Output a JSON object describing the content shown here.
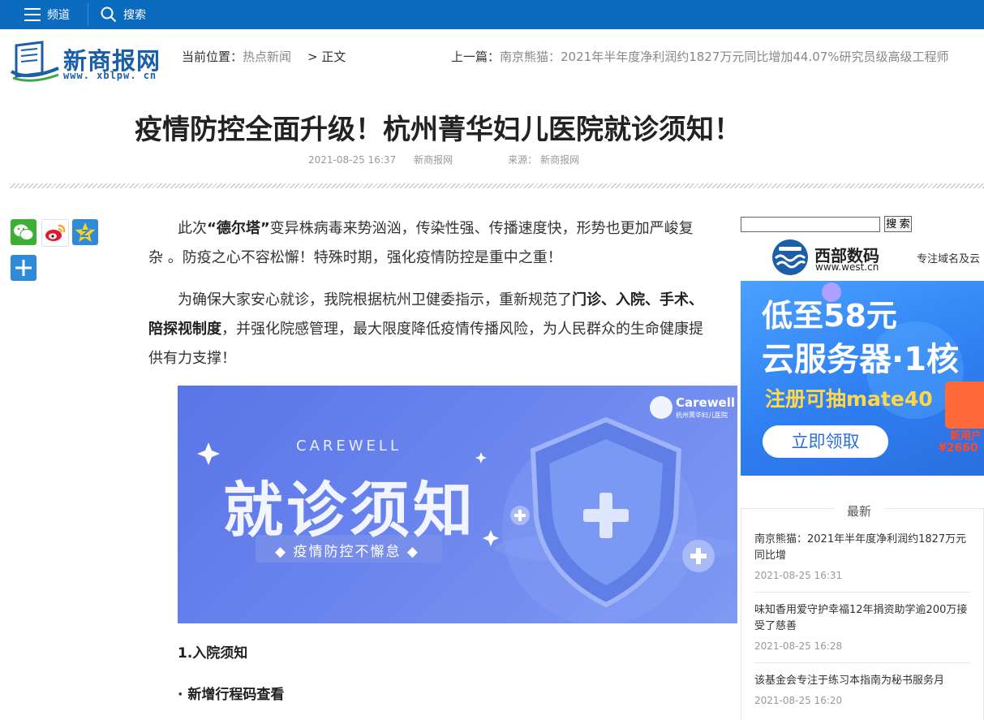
{
  "topbar": {
    "channel_label": "频道",
    "search_label": "搜索"
  },
  "header": {
    "logo_text": "新商报网",
    "logo_url": "www. xblpw. cn",
    "breadcrumb_label": "当前位置：",
    "breadcrumb_section": "热点新闻",
    "breadcrumb_current": "> 正文",
    "prev_label": "上一篇：",
    "prev_title": "南京熊猫：2021年半年度净利润约1827万元同比增加44.07%研究员级高级工程师"
  },
  "article": {
    "title": "疫情防控全面升级！杭州菁华妇儿医院就诊须知！",
    "datetime": "2021-08-25 16:37",
    "publisher": "新商报网",
    "source_label": "来源：",
    "source": "新商报网",
    "p1": {
      "a": "此次",
      "b": "“德尔塔”",
      "c": "变异株病毒来势汹汹，传染性强、传播速度快，形势也更加严峻复杂 。防疫之心不容松懈！特殊时期，强化疫情防控是重中之重！"
    },
    "p2": {
      "a": "为确保大家安心就诊，我院根据杭州卫健委指示，重新规范了",
      "b": "门诊、入院、手术、陪探视制度",
      "c": "，并强化院感管理，最大限度降低疫情传播风险，为人民群众的生命健康提供有力支撑！"
    },
    "banner": {
      "brand": "Carewell",
      "brand_sub": "杭州菁华妇儿医院",
      "eyebrow": "CAREWELL",
      "headline": "就诊须知",
      "tagline": "◆ 疫情防控不懈怠 ◆"
    },
    "section1": "1.入院须知",
    "section1_sub": "· 新增行程码查看"
  },
  "share": {
    "icons": [
      "wechat-icon",
      "weibo-icon",
      "qzone-icon",
      "more-share-icon"
    ]
  },
  "sidebar": {
    "search_button": "搜 索",
    "west_name": "西部数码",
    "west_url": "www.west.cn",
    "west_slogan": "专注域名及云",
    "ad": {
      "line1": "低至58元",
      "line2": "云服务器·1核",
      "line3": "注册可抽mate40",
      "button": "立即领取",
      "badge": "新用户",
      "price": "¥2660"
    },
    "latest_title": "最新",
    "latest": [
      {
        "title": "南京熊猫：2021年半年度净利润约1827万元同比增",
        "time": "2021-08-25 16:31"
      },
      {
        "title": "味知香用爱守护幸福12年捐资助学逾200万接受了慈善",
        "time": "2021-08-25 16:28"
      },
      {
        "title": "该基金会专注于练习本指南为秘书服务月",
        "time": "2021-08-25 16:20"
      }
    ]
  },
  "colors": {
    "topbar": "#0a6bbf",
    "brand": "#1a5fa8",
    "banner": "#6a84ee",
    "ad": "#2f7ff2"
  }
}
